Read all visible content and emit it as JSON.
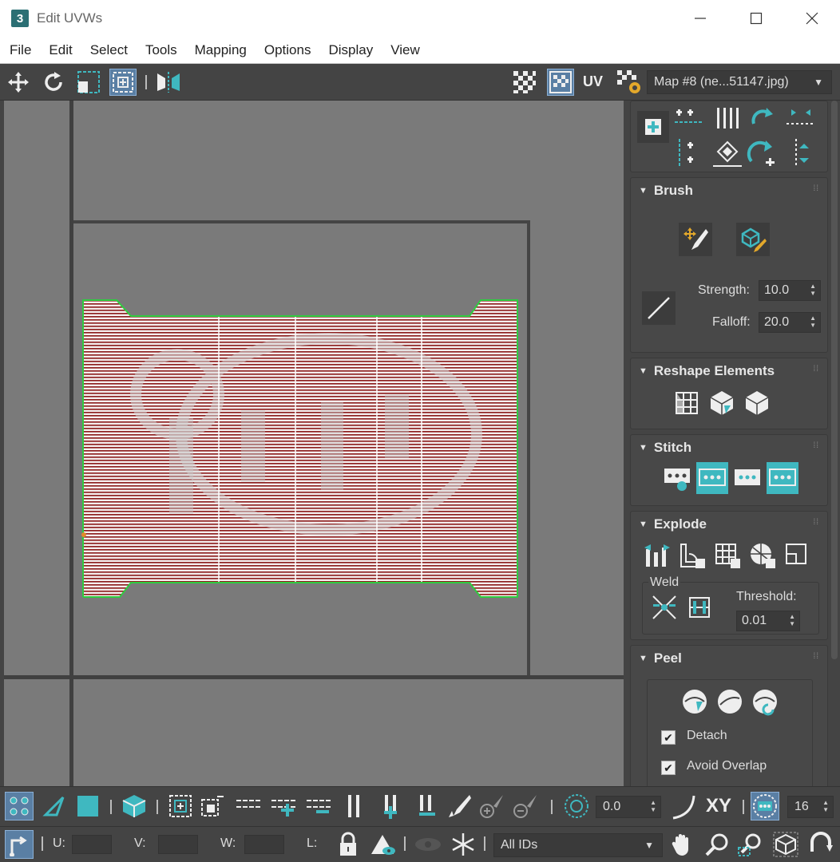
{
  "window": {
    "title": "Edit UVWs",
    "app_icon": "3",
    "controls": [
      "minimize",
      "maximize",
      "close"
    ]
  },
  "menu": [
    "File",
    "Edit",
    "Select",
    "Tools",
    "Mapping",
    "Options",
    "Display",
    "View"
  ],
  "toolbar": {
    "uv_label": "UV",
    "map_select": "Map #8 (ne...51147.jpg)"
  },
  "panel": {
    "brush": {
      "title": "Brush",
      "strength_label": "Strength:",
      "strength_value": "10.0",
      "falloff_label": "Falloff:",
      "falloff_value": "20.0"
    },
    "reshape": {
      "title": "Reshape Elements"
    },
    "stitch": {
      "title": "Stitch"
    },
    "explode": {
      "title": "Explode",
      "weld_label": "Weld",
      "threshold_label": "Threshold:",
      "threshold_value": "0.01"
    },
    "peel": {
      "title": "Peel",
      "detach_label": "Detach",
      "detach_checked": true,
      "avoid_overlap_label": "Avoid Overlap",
      "avoid_overlap_checked": true
    }
  },
  "bottom": {
    "angle_value": "0.0",
    "xy_label": "XY",
    "grid_value": "16",
    "u_label": "U:",
    "v_label": "V:",
    "w_label": "W:",
    "l_label": "L:",
    "id_select": "All IDs"
  },
  "colors": {
    "accent": "#3fb8c0",
    "active_bg": "#5a7fa4",
    "mesh_line": "#8b1a1a",
    "edge_select": "#2ecc40"
  }
}
